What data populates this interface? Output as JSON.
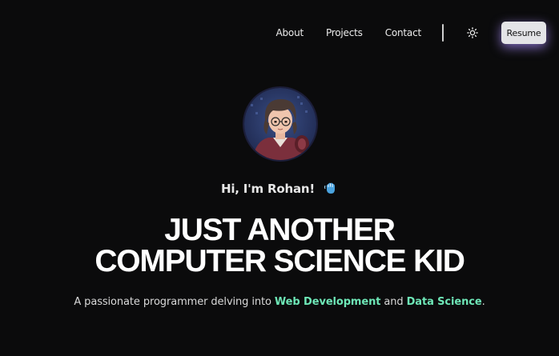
{
  "nav": {
    "links": [
      {
        "label": "About"
      },
      {
        "label": "Projects"
      },
      {
        "label": "Contact"
      }
    ],
    "theme_icon": "sun-icon",
    "resume_label": "Resume"
  },
  "hero": {
    "avatar_icon": "avatar-illustration",
    "greeting": "Hi, I'm Rohan!",
    "greeting_icon": "wave-emoji-icon",
    "headline_line1": "JUST ANOTHER",
    "headline_line2": "COMPUTER SCIENCE KID",
    "tagline_prefix": "A passionate programmer delving into ",
    "tagline_highlight1": "Web Development",
    "tagline_middle": " and ",
    "tagline_highlight2": "Data Science",
    "tagline_suffix": "."
  },
  "colors": {
    "background": "#0b0b0c",
    "accent_highlight": "#6ee7b7",
    "resume_glow": "#a78bfa"
  }
}
